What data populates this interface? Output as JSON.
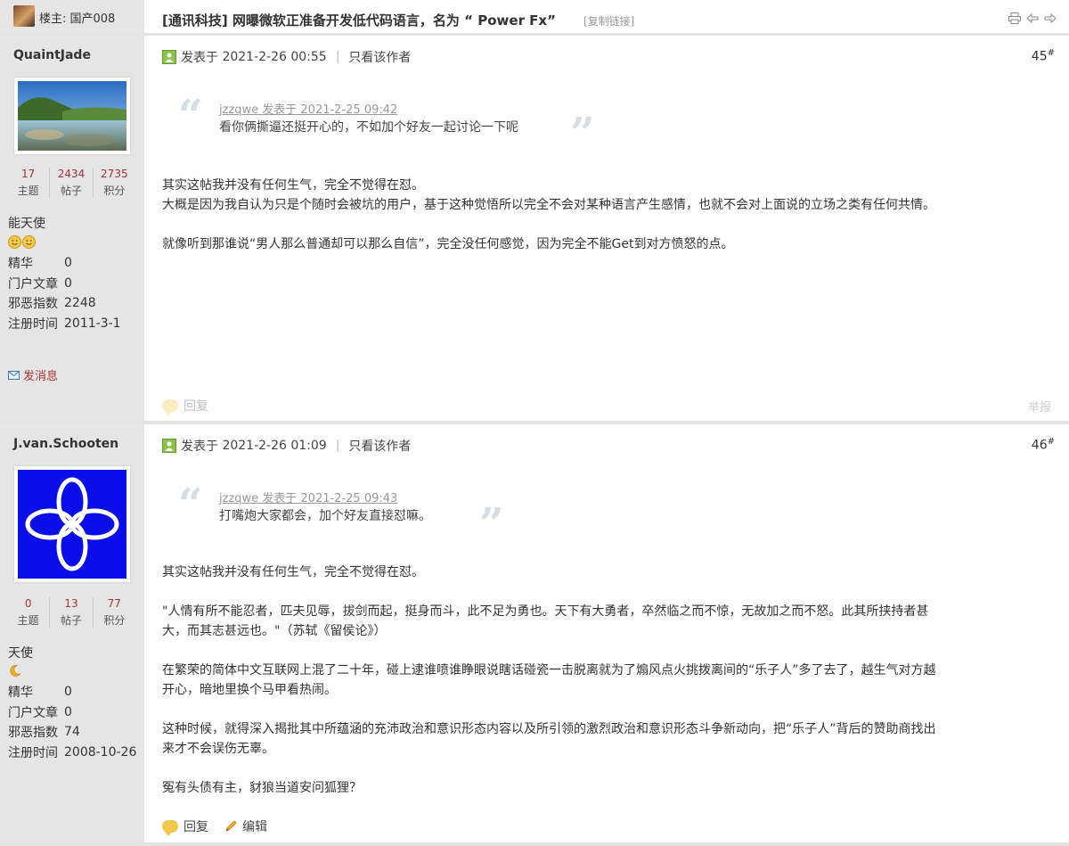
{
  "thread": {
    "owner_label": "楼主: 国产008",
    "title": "[通讯科技] 网曝微软正准备开发低代码语言，名为 “ Power Fx”",
    "copy_link": "[复制链接]",
    "tool_icons": [
      "print-icon",
      "prev-thread-icon",
      "next-thread-icon"
    ]
  },
  "profile_labels": {
    "topics": "主题",
    "posts": "帖子",
    "credits": "积分",
    "essence": "精华",
    "portal_articles": "门户文章",
    "evil_index": "邪恶指数",
    "register_time": "注册时间"
  },
  "common": {
    "posted_at_prefix": "发表于",
    "only_author": "只看该作者",
    "reply": "回复",
    "report": "举报",
    "edit": "编辑",
    "send_message": "发消息",
    "floor_mark": "#"
  },
  "posts": [
    {
      "author": "QuaintJade",
      "stats": {
        "topics": "17",
        "posts": "2434",
        "credits": "2735"
      },
      "rank": "能天使",
      "rank_icons": [
        "smiley-icon",
        "smiley-icon"
      ],
      "profile": {
        "essence": "0",
        "portal_articles": "0",
        "evil_index": "2248",
        "register_time": "2011-3-1"
      },
      "posted_at": "2021-2-26 00:55",
      "floor": "45",
      "quote": {
        "source": "jzzqwe 发表于 2021-2-25 09:42",
        "text": "看你俩撕逼还挺开心的，不如加个好友一起讨论一下呢"
      },
      "paragraphs": [
        "其实这帖我并没有任何生气，完全不觉得在怼。\n大概是因为我自认为只是个随时会被坑的用户，基于这种觉悟所以完全不会对某种语言产生感情，也就不会对上面说的立场之类有任何共情。",
        "就像听到那谁说“男人那么普通却可以那么自信”，完全没任何感觉，因为完全不能Get到对方愤怒的点。"
      ]
    },
    {
      "author": "J.van.Schooten",
      "stats": {
        "topics": "0",
        "posts": "13",
        "credits": "77"
      },
      "rank": "天使",
      "rank_icons": [
        "moon-icon"
      ],
      "profile": {
        "essence": "0",
        "portal_articles": "0",
        "evil_index": "74",
        "register_time": "2008-10-26"
      },
      "posted_at": "2021-2-26 01:09",
      "floor": "46",
      "quote": {
        "source": "jzzqwe 发表于 2021-2-25 09:43",
        "text": "打嘴炮大家都会，加个好友直接怼嘛。"
      },
      "paragraphs": [
        "其实这帖我并没有任何生气，完全不觉得在怼。",
        "\"人情有所不能忍者，匹夫见辱，拔剑而起，挺身而斗，此不足为勇也。天下有大勇者，卒然临之而不惊，无故加之而不怒。此其所挟持者甚大，而其志甚远也。\"（苏轼《留侯论》）",
        "在繁荣的简体中文互联网上混了二十年，碰上逮谁喷谁睁眼说瞎话碰瓷一击脱离就为了煽风点火挑拨离间的“乐子人”多了去了，越生气对方越开心，暗地里换个马甲看热闹。",
        "这种时候，就得深入揭批其中所蕴涵的充沛政治和意识形态内容以及所引领的激烈政治和意识形态斗争新动向，把“乐子人”背后的赞助商找出来才不会误伤无辜。",
        "冤有头债有主，豺狼当道安问狐狸？"
      ]
    }
  ]
}
